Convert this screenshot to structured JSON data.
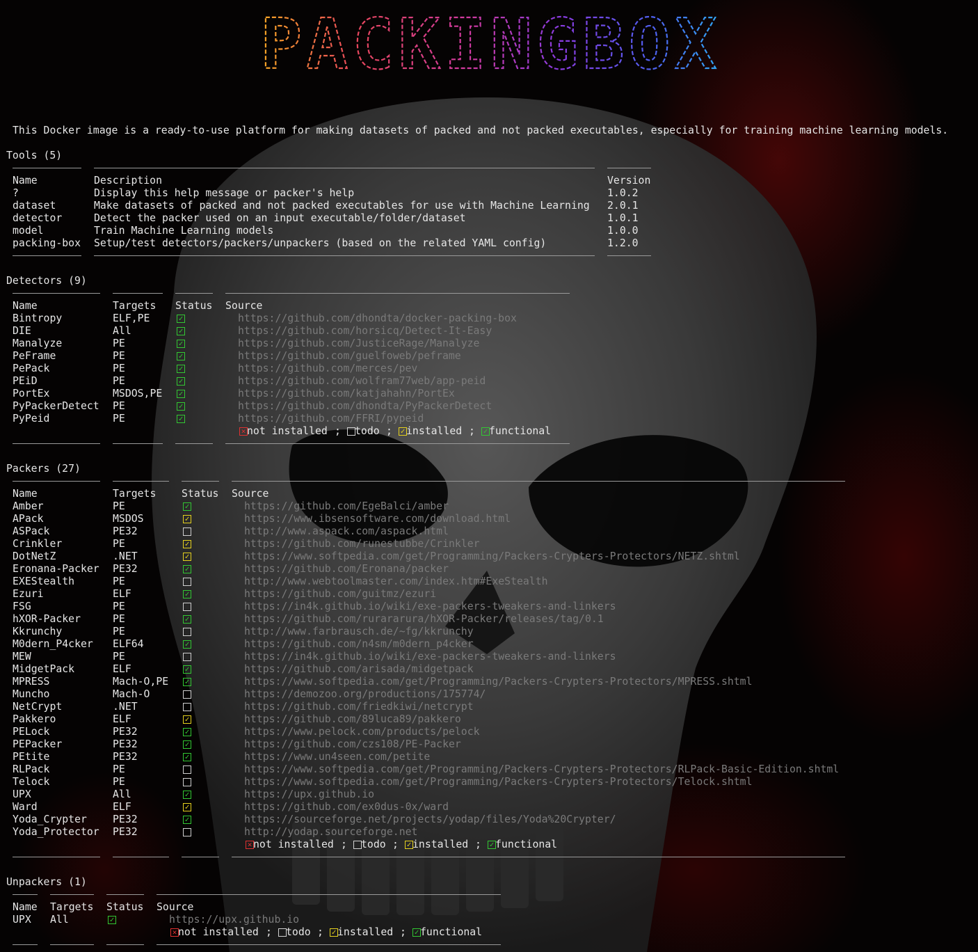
{
  "banner": {
    "title": "PACKINGBOX"
  },
  "intro": "This Docker image is a ready-to-use platform for making datasets of packed and not packed executables, especially for training machine learning models.",
  "tools": {
    "title": "Tools (5)",
    "headers": [
      "Name",
      "Description",
      "Version"
    ],
    "rows": [
      {
        "name": "?",
        "description": "Display this help message or packer's help",
        "version": "1.0.2"
      },
      {
        "name": "dataset",
        "description": "Make datasets of packed and not packed executables for use with Machine Learning",
        "version": "2.0.1"
      },
      {
        "name": "detector",
        "description": "Detect the packer used on an input executable/folder/dataset",
        "version": "1.0.1"
      },
      {
        "name": "model",
        "description": "Train Machine Learning models",
        "version": "1.0.0"
      },
      {
        "name": "packing-box",
        "description": "Setup/test detectors/packers/unpackers (based on the related YAML config)",
        "version": "1.2.0"
      }
    ]
  },
  "detectors": {
    "title": "Detectors (9)",
    "headers": [
      "Name",
      "Targets",
      "Status",
      "Source"
    ],
    "rows": [
      {
        "name": "Bintropy",
        "targets": "ELF,PE",
        "status": "functional",
        "source": "https://github.com/dhondta/docker-packing-box"
      },
      {
        "name": "DIE",
        "targets": "All",
        "status": "functional",
        "source": "https://github.com/horsicq/Detect-It-Easy"
      },
      {
        "name": "Manalyze",
        "targets": "PE",
        "status": "functional",
        "source": "https://github.com/JusticeRage/Manalyze"
      },
      {
        "name": "PeFrame",
        "targets": "PE",
        "status": "functional",
        "source": "https://github.com/guelfoweb/peframe"
      },
      {
        "name": "PePack",
        "targets": "PE",
        "status": "functional",
        "source": "https://github.com/merces/pev"
      },
      {
        "name": "PEiD",
        "targets": "PE",
        "status": "functional",
        "source": "https://github.com/wolfram77web/app-peid"
      },
      {
        "name": "PortEx",
        "targets": "MSDOS,PE",
        "status": "functional",
        "source": "https://github.com/katjahahn/PortEx"
      },
      {
        "name": "PyPackerDetect",
        "targets": "PE",
        "status": "functional",
        "source": "https://github.com/dhondta/PyPackerDetect"
      },
      {
        "name": "PyPeid",
        "targets": "PE",
        "status": "functional",
        "source": "https://github.com/FFRI/pypeid"
      }
    ]
  },
  "packers": {
    "title": "Packers (27)",
    "headers": [
      "Name",
      "Targets",
      "Status",
      "Source"
    ],
    "rows": [
      {
        "name": "Amber",
        "targets": "PE",
        "status": "functional",
        "source": "https://github.com/EgeBalci/amber"
      },
      {
        "name": "APack",
        "targets": "MSDOS",
        "status": "installed",
        "source": "https://www.ibsensoftware.com/download.html"
      },
      {
        "name": "ASPack",
        "targets": "PE32",
        "status": "todo",
        "source": "http://www.aspack.com/aspack.html"
      },
      {
        "name": "Crinkler",
        "targets": "PE",
        "status": "installed",
        "source": "https://github.com/runestubbe/Crinkler"
      },
      {
        "name": "DotNetZ",
        "targets": ".NET",
        "status": "installed",
        "source": "https://www.softpedia.com/get/Programming/Packers-Crypters-Protectors/NETZ.shtml"
      },
      {
        "name": "Eronana-Packer",
        "targets": "PE32",
        "status": "functional",
        "source": "https://github.com/Eronana/packer"
      },
      {
        "name": "EXEStealth",
        "targets": "PE",
        "status": "todo",
        "source": "http://www.webtoolmaster.com/index.htm#ExeStealth"
      },
      {
        "name": "Ezuri",
        "targets": "ELF",
        "status": "functional",
        "source": "https://github.com/guitmz/ezuri"
      },
      {
        "name": "FSG",
        "targets": "PE",
        "status": "todo",
        "source": "https://in4k.github.io/wiki/exe-packers-tweakers-and-linkers"
      },
      {
        "name": "hXOR-Packer",
        "targets": "PE",
        "status": "functional",
        "source": "https://github.com/rurararura/hXOR-Packer/releases/tag/0.1"
      },
      {
        "name": "Kkrunchy",
        "targets": "PE",
        "status": "todo",
        "source": "http://www.farbrausch.de/~fg/kkrunchy"
      },
      {
        "name": "M0dern_P4cker",
        "targets": "ELF64",
        "status": "functional",
        "source": "https://github.com/n4sm/m0dern_p4cker"
      },
      {
        "name": "MEW",
        "targets": "PE",
        "status": "todo",
        "source": "https://in4k.github.io/wiki/exe-packers-tweakers-and-linkers"
      },
      {
        "name": "MidgetPack",
        "targets": "ELF",
        "status": "functional",
        "source": "https://github.com/arisada/midgetpack"
      },
      {
        "name": "MPRESS",
        "targets": "Mach-O,PE",
        "status": "functional",
        "source": "https://www.softpedia.com/get/Programming/Packers-Crypters-Protectors/MPRESS.shtml"
      },
      {
        "name": "Muncho",
        "targets": "Mach-O",
        "status": "todo",
        "source": "https://demozoo.org/productions/175774/"
      },
      {
        "name": "NetCrypt",
        "targets": ".NET",
        "status": "todo",
        "source": "https://github.com/friedkiwi/netcrypt"
      },
      {
        "name": "Pakkero",
        "targets": "ELF",
        "status": "installed",
        "source": "https://github.com/89luca89/pakkero"
      },
      {
        "name": "PELock",
        "targets": "PE32",
        "status": "functional",
        "source": "https://www.pelock.com/products/pelock"
      },
      {
        "name": "PEPacker",
        "targets": "PE32",
        "status": "functional",
        "source": "https://github.com/czs108/PE-Packer"
      },
      {
        "name": "PEtite",
        "targets": "PE32",
        "status": "functional",
        "source": "https://www.un4seen.com/petite"
      },
      {
        "name": "RLPack",
        "targets": "PE",
        "status": "todo",
        "source": "https://www.softpedia.com/get/Programming/Packers-Crypters-Protectors/RLPack-Basic-Edition.shtml"
      },
      {
        "name": "Telock",
        "targets": "PE",
        "status": "todo",
        "source": "https://www.softpedia.com/get/Programming/Packers-Crypters-Protectors/Telock.shtml"
      },
      {
        "name": "UPX",
        "targets": "All",
        "status": "functional",
        "source": "https://upx.github.io"
      },
      {
        "name": "Ward",
        "targets": "ELF",
        "status": "installed",
        "source": "https://github.com/ex0dus-0x/ward"
      },
      {
        "name": "Yoda_Crypter",
        "targets": "PE32",
        "status": "functional",
        "source": "https://sourceforge.net/projects/yodap/files/Yoda%20Crypter/"
      },
      {
        "name": "Yoda_Protector",
        "targets": "PE32",
        "status": "todo",
        "source": "http://yodap.sourceforge.net"
      }
    ]
  },
  "unpackers": {
    "title": "Unpackers (1)",
    "headers": [
      "Name",
      "Targets",
      "Status",
      "Source"
    ],
    "rows": [
      {
        "name": "UPX",
        "targets": "All",
        "status": "functional",
        "source": "https://upx.github.io"
      }
    ]
  },
  "legend": {
    "not_installed": "not installed",
    "todo": "todo",
    "installed": "installed",
    "functional": "functional",
    "separator": ";"
  },
  "colors": {
    "functional": "#32c832",
    "installed": "#e6d21e",
    "not_installed": "#e03030",
    "url": "#7a7a7a",
    "text": "#e6e6e6"
  }
}
